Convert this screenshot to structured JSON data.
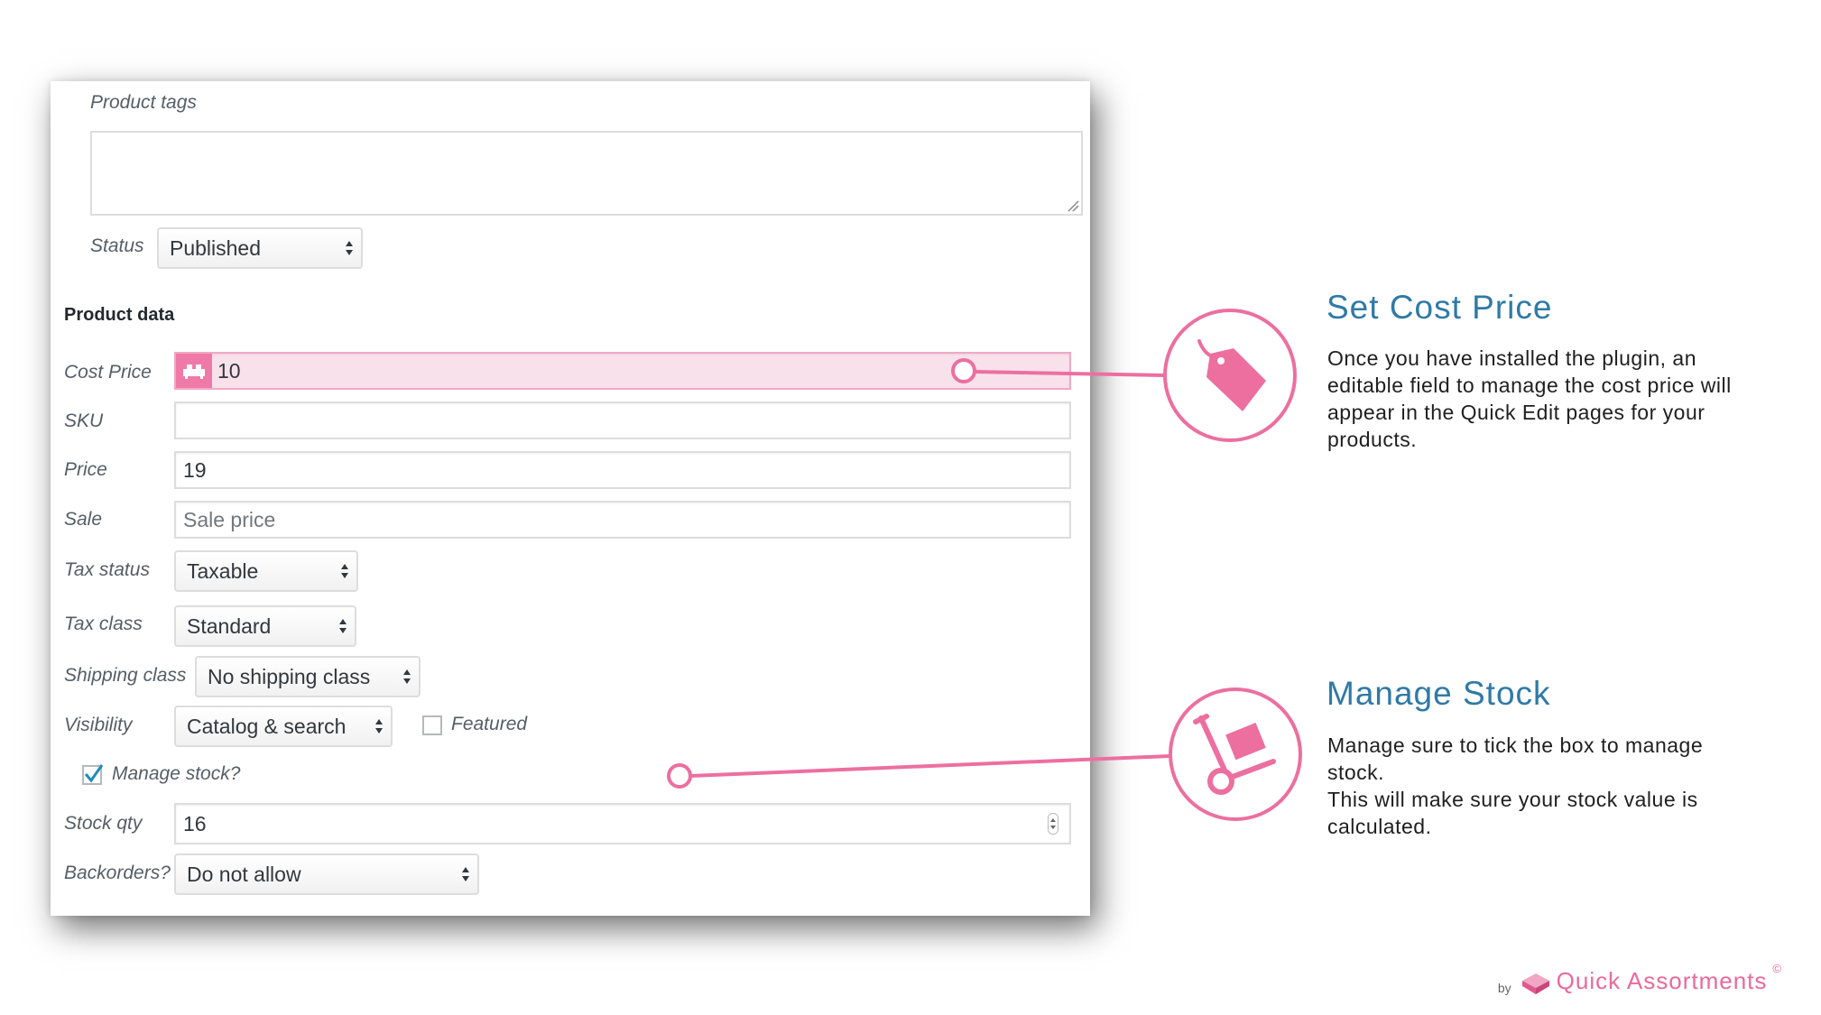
{
  "form": {
    "product_tags_label": "Product tags",
    "product_tags_value": "",
    "status_label": "Status",
    "status_value": "Published",
    "product_data_heading": "Product data",
    "cost_price_label": "Cost Price",
    "cost_price_value": "10",
    "sku_label": "SKU",
    "sku_value": "",
    "price_label": "Price",
    "price_value": "19",
    "sale_label": "Sale",
    "sale_placeholder": "Sale price",
    "tax_status_label": "Tax status",
    "tax_status_value": "Taxable",
    "tax_class_label": "Tax class",
    "tax_class_value": "Standard",
    "shipping_class_label": "Shipping class",
    "shipping_class_value": "No shipping class",
    "visibility_label": "Visibility",
    "visibility_value": "Catalog & search",
    "featured_label": "Featured",
    "featured_checked": false,
    "manage_stock_label": "Manage stock?",
    "manage_stock_checked": true,
    "stock_qty_label": "Stock qty",
    "stock_qty_value": "16",
    "backorders_label": "Backorders?",
    "backorders_value": "Do not allow"
  },
  "callouts": {
    "cost": {
      "title": "Set Cost Price",
      "description": "Once you have installed the plugin, an editable field to manage the cost price will appear in the Quick Edit pages for your products.",
      "icon": "price-tag-icon"
    },
    "stock": {
      "title": "Manage Stock",
      "description_line1": "Manage sure to tick the box to manage stock.",
      "description_line2": "This will make sure your stock value is calculated.",
      "icon": "hand-truck-icon"
    }
  },
  "branding": {
    "by": "by",
    "name": "Quick Assortments",
    "copyright": "©"
  },
  "colors": {
    "accent_pink": "#ef7aa8",
    "title_blue": "#2f7aa6",
    "cost_field_bg": "#f9e1eb"
  }
}
